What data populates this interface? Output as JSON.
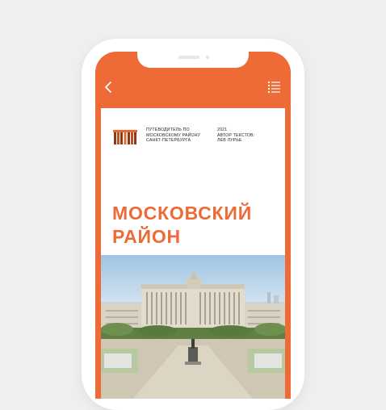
{
  "guide": {
    "lines": [
      "ПУТЕВОДИТЕЛЬ ПО",
      "МОСКОВСКОМУ РАЙОНУ",
      "САНКТ-ПЕТЕРБУРГА"
    ]
  },
  "meta": {
    "year": "2021",
    "author_label": "АВТОР ТЕКСТОВ:",
    "author_name": "ЛЕВ ЛУРЬЕ"
  },
  "title": {
    "line1": "МОСКОВСКИЙ",
    "line2": "РАЙОН"
  },
  "icons": {
    "back": "chevron-left-icon",
    "menu": "list-menu-icon",
    "logo": "guide-logo"
  },
  "colors": {
    "accent": "#ee6a36",
    "background": "#efefef",
    "page": "#ffffff"
  }
}
